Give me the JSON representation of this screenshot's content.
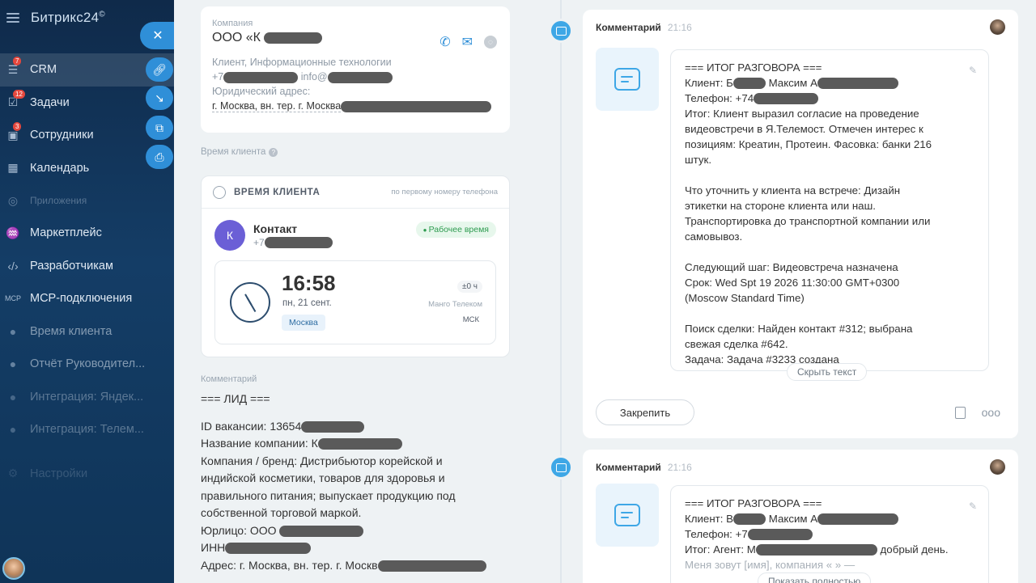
{
  "sidebar": {
    "logo": "Битрикс24",
    "logo_mark": "©",
    "items": [
      {
        "label": "CRM",
        "badge": "7",
        "icon": "filter-icon"
      },
      {
        "label": "Задачи",
        "badge": "12",
        "icon": "tasks-icon"
      },
      {
        "label": "Сотрудники",
        "badge": "3",
        "icon": "employees-icon"
      },
      {
        "label": "Календарь",
        "badge": "",
        "icon": "calendar-icon"
      },
      {
        "label": "Приложения",
        "badge": "",
        "icon": "apps-icon"
      },
      {
        "label": "Маркетплейс",
        "badge": "",
        "icon": "marketplace-icon"
      },
      {
        "label": "Разработчикам",
        "badge": "",
        "icon": "code-icon"
      },
      {
        "label": "МСР-подключения",
        "badge": "",
        "icon": "mcp-icon"
      },
      {
        "label": "Время клиента",
        "badge": "",
        "icon": "client-time-icon"
      },
      {
        "label": "Отчёт Руководител...",
        "badge": "",
        "icon": "report-icon"
      },
      {
        "label": "Интеграция: Яндек...",
        "badge": "",
        "icon": "integration-icon"
      },
      {
        "label": "Интеграция: Телем...",
        "badge": "",
        "icon": "integration-icon"
      },
      {
        "label": "Настройки",
        "badge": "",
        "icon": "settings-icon"
      }
    ]
  },
  "company": {
    "label": "Компания",
    "name": "ООО «К",
    "category": "Клиент, Информационные технологии",
    "phone_prefix": "+7",
    "email_prefix": "info@",
    "legal_label": "Юридический адрес:",
    "address": "г. Москва, вн. тер. г. Москва"
  },
  "client_time": {
    "section_label": "Время клиента",
    "card_title": "ВРЕМЯ КЛИЕНТА",
    "card_hint": "по первому номеру телефона",
    "contact_initial": "К",
    "contact_name": "Контакт",
    "contact_phone": "+7",
    "status": "Рабочее время",
    "time": "16:58",
    "date": "пн, 21 сент.",
    "city": "Москва",
    "offset": "±0 ч",
    "operator": "Манго Телеком",
    "tz": "МСК"
  },
  "lead_comment": {
    "label": "Комментарий",
    "lines": [
      "=== ЛИД ===",
      "",
      "ID вакансии: 13654",
      "Название компании: К",
      "Компания / бренд: Дистрибьютор корейской и",
      "индийской косметики, товаров для здоровья и",
      "правильного питания; выпускает продукцию под",
      "собственной торговой маркой.",
      "Юрлицо: ООО",
      "ИНН",
      "Адрес: г. Москва, вн. тер. г. Москв"
    ]
  },
  "feed": [
    {
      "type": "Комментарий",
      "time": "21:16",
      "lines": [
        "=== ИТОГ РАЗГОВОРА ===",
        "Клиент: Б         Максим А",
        "Телефон: +74",
        "Итог: Клиент выразил согласие на проведение",
        "видеовстречи в Я.Телемост. Отмечен интерес к",
        "позициям: Креатин, Протеин. Фасовка: банки 216",
        "штук.",
        "",
        "Что уточнить у клиента на встрече: Дизайн",
        "этикетки на стороне клиента или наш.",
        "Транспортировка до транспортной компании или",
        "самовывоз.",
        "",
        "Следующий шаг: Видеовстреча назначена",
        "Срок: Wed Spt 19 2026 11:30:00 GMT+0300",
        "(Moscow Standard Time)",
        "",
        "Поиск сделки: Найден контакт #312; выбрана",
        "свежая сделка #642.",
        "Задача: Задача #3233 создана"
      ],
      "toggle": "Скрыть текст",
      "pin": "Закрепить",
      "more": "ooo"
    },
    {
      "type": "Комментарий",
      "time": "21:16",
      "lines": [
        "=== ИТОГ РАЗГОВОРА ===",
        "Клиент: В         Максим А",
        "Телефон: +7",
        "Итог: Агент: М                        добрый день.",
        "Меня зовут [имя], компания «          » —"
      ],
      "toggle": "Показать полностью"
    }
  ]
}
